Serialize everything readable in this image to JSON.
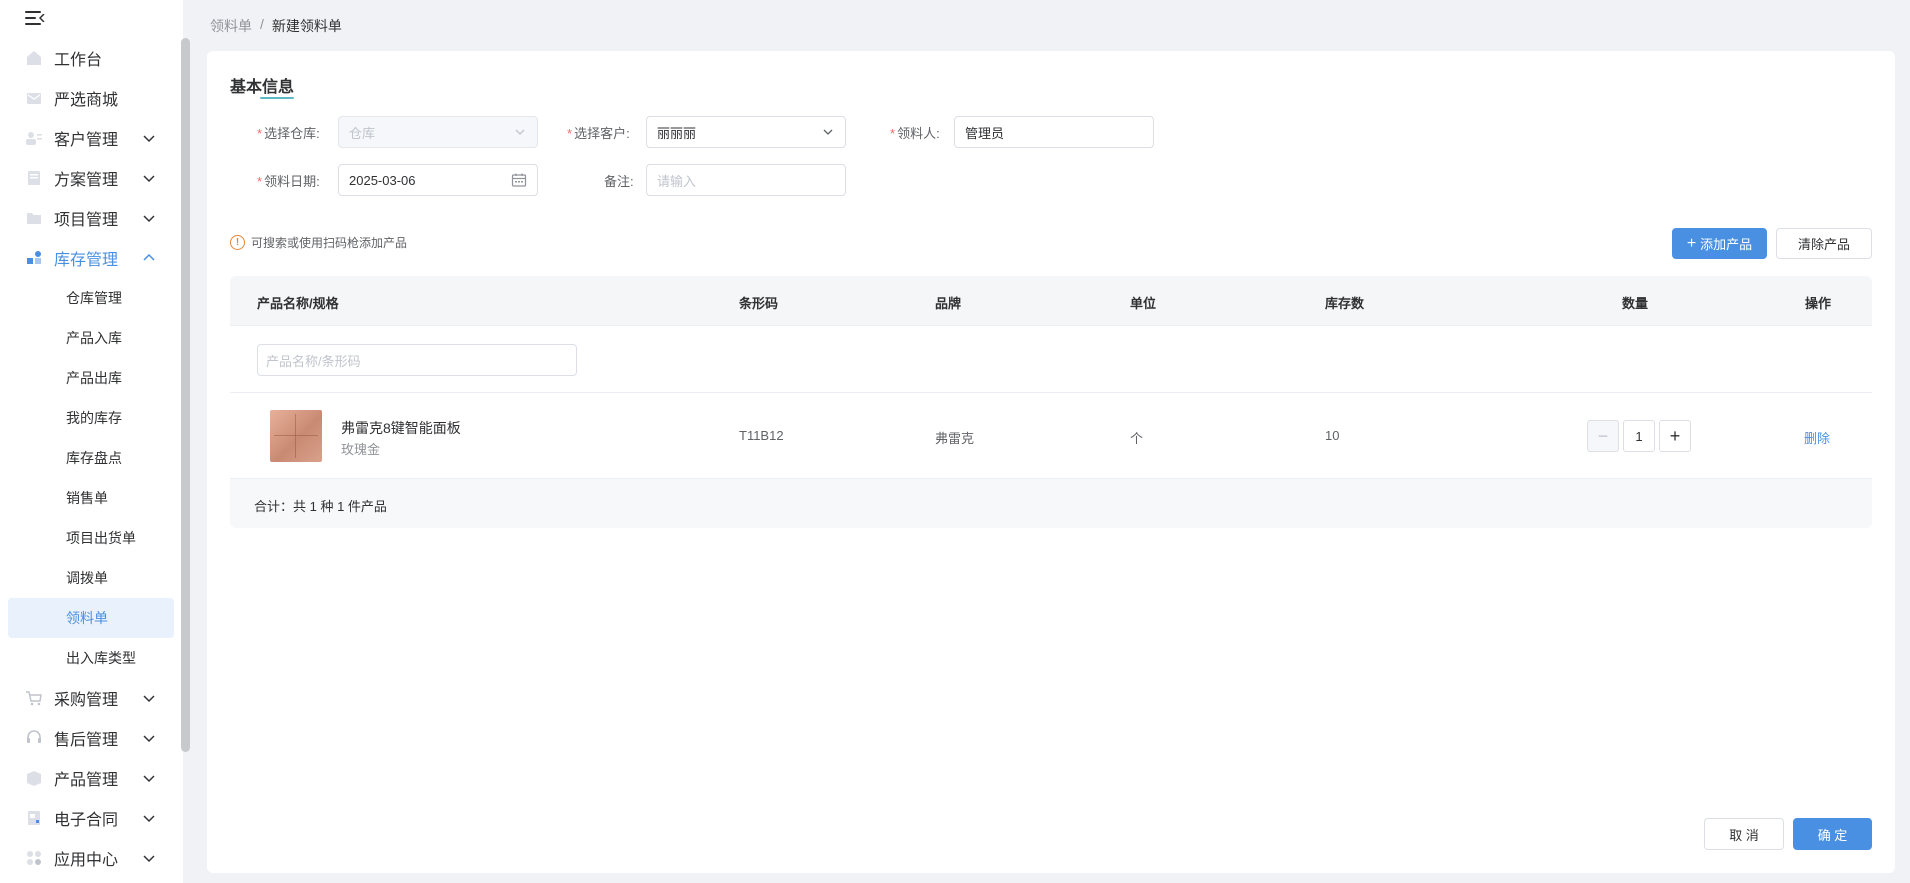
{
  "sidebar": {
    "items": [
      {
        "label": "工作台",
        "icon": "home-icon",
        "has_arrow": false
      },
      {
        "label": "严选商城",
        "icon": "mail-icon",
        "has_arrow": false
      },
      {
        "label": "客户管理",
        "icon": "user-card-icon",
        "has_arrow": true
      },
      {
        "label": "方案管理",
        "icon": "document-icon",
        "has_arrow": true
      },
      {
        "label": "项目管理",
        "icon": "folder-icon",
        "has_arrow": true
      },
      {
        "label": "库存管理",
        "icon": "grid-icon",
        "has_arrow": true,
        "open": true
      }
    ],
    "sub_items": [
      "仓库管理",
      "产品入库",
      "产品出库",
      "我的库存",
      "库存盘点",
      "销售单",
      "项目出货单",
      "调拨单",
      "领料单",
      "出入库类型"
    ],
    "active_sub": 8,
    "items_after": [
      {
        "label": "采购管理",
        "icon": "cart-icon"
      },
      {
        "label": "售后管理",
        "icon": "headset-icon"
      },
      {
        "label": "产品管理",
        "icon": "box-icon"
      },
      {
        "label": "电子合同",
        "icon": "contract-icon"
      },
      {
        "label": "应用中心",
        "icon": "apps-icon"
      }
    ]
  },
  "breadcrumb": {
    "parent": "领料单",
    "separator": "/",
    "current": "新建领料单"
  },
  "form": {
    "section_title": "基本信息",
    "warehouse": {
      "label": "选择仓库:",
      "placeholder": "仓库"
    },
    "customer": {
      "label": "选择客户:",
      "value": "丽丽丽"
    },
    "picker": {
      "label": "领料人:",
      "value": "管理员"
    },
    "date": {
      "label": "领料日期:",
      "value": "2025-03-06"
    },
    "remark": {
      "label": "备注:",
      "placeholder": "请输入"
    }
  },
  "tip": "可搜索或使用扫码枪添加产品",
  "buttons": {
    "add_product": "添加产品",
    "clear_product": "清除产品",
    "cancel": "取 消",
    "confirm": "确 定"
  },
  "table": {
    "headers": [
      "产品名称/规格",
      "条形码",
      "品牌",
      "单位",
      "库存数",
      "数量",
      "操作"
    ],
    "search_placeholder": "产品名称/条形码",
    "rows": [
      {
        "name": "弗雷克8键智能面板",
        "spec": "玫瑰金",
        "barcode": "T11B12",
        "brand": "弗雷克",
        "unit": "个",
        "stock": "10",
        "qty": "1",
        "action": "删除"
      }
    ],
    "total": "合计：共 1 种 1 件产品"
  },
  "colors": {
    "primary": "#4a90e2",
    "required": "#f56c6c",
    "warning": "#e6863a"
  }
}
